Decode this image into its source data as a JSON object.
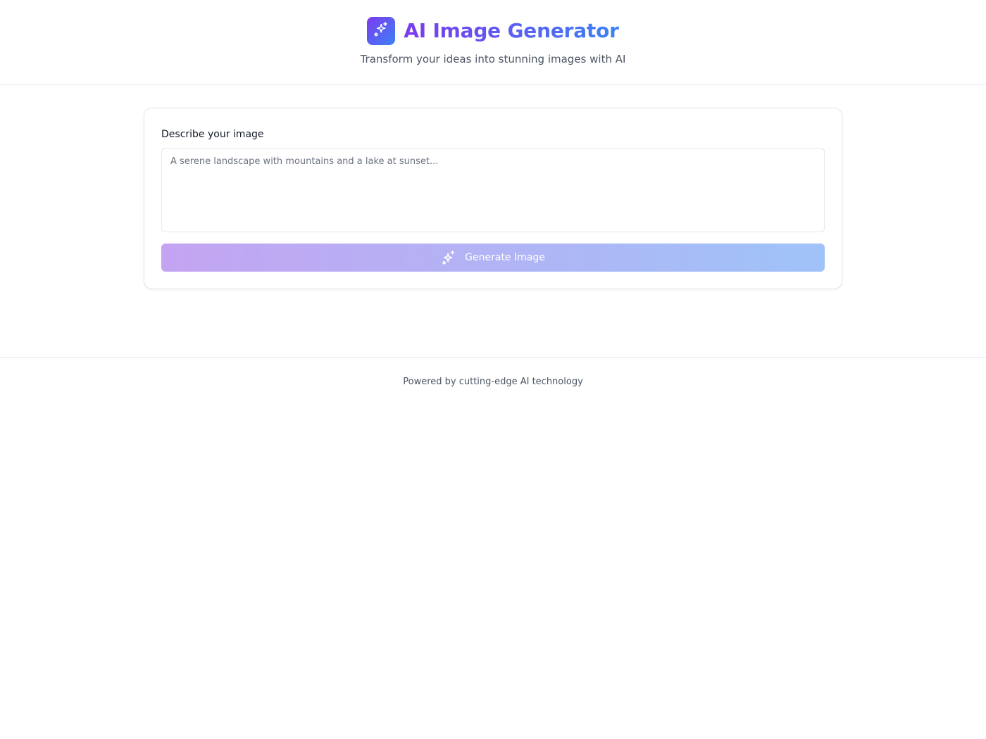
{
  "header": {
    "title": "AI Image Generator",
    "subtitle": "Transform your ideas into stunning images with AI",
    "logo_icon": "sparkles-icon"
  },
  "prompt": {
    "label": "Describe your image",
    "placeholder": "A serene landscape with mountains and a lake at sunset...",
    "value": ""
  },
  "generate_button": {
    "label": "Generate Image",
    "icon": "sparkles-icon",
    "state": "disabled"
  },
  "footer": {
    "text": "Powered by cutting-edge AI technology"
  },
  "colors": {
    "gradient_start": "#7c3aed",
    "gradient_end": "#3b82f6",
    "border": "#e5e7eb",
    "muted_text": "#4b5563"
  }
}
